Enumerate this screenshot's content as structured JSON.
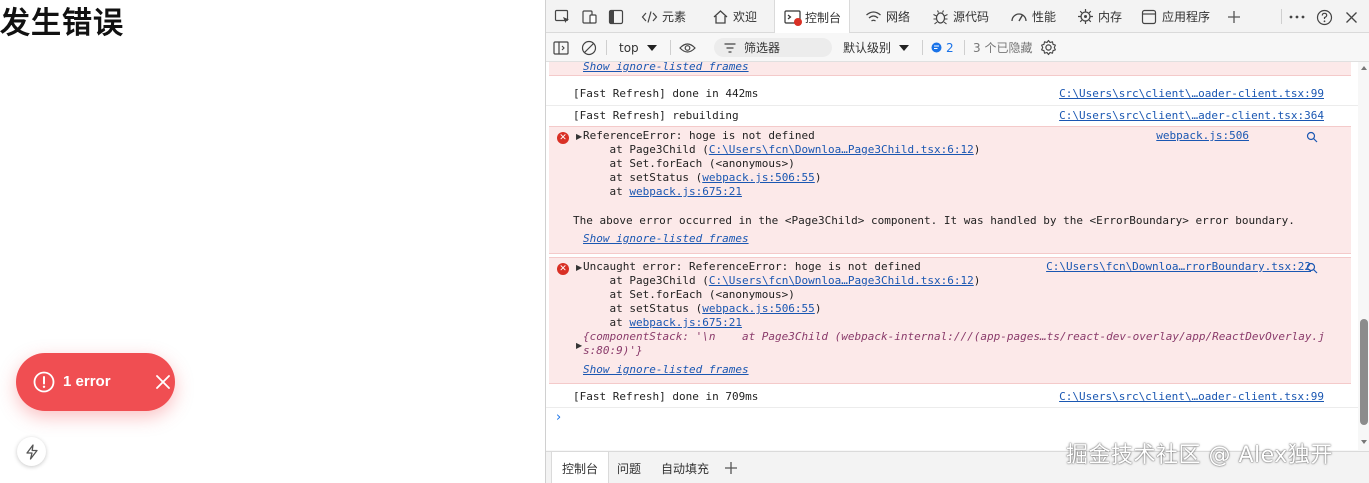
{
  "page": {
    "title": "发生错误",
    "toast": {
      "label": "1 error"
    }
  },
  "devtools": {
    "tabs": [
      {
        "label": "元素",
        "icon": "code-icon"
      },
      {
        "label": "欢迎",
        "icon": "home-icon"
      },
      {
        "label": "控制台",
        "icon": "console-icon"
      },
      {
        "label": "网络",
        "icon": "wifi-icon"
      },
      {
        "label": "源代码",
        "icon": "bug-icon"
      },
      {
        "label": "性能",
        "icon": "performance-icon"
      },
      {
        "label": "内存",
        "icon": "memory-icon"
      },
      {
        "label": "应用程序",
        "icon": "application-icon"
      }
    ],
    "toolbar": {
      "context": "top",
      "filter_placeholder": "筛选器",
      "level": "默认级别",
      "issues_count": "2",
      "hidden": "3 个已隐藏"
    },
    "console": {
      "show_frames": "Show ignore-listed frames",
      "rows": [
        {
          "msg": "[Fast Refresh] done in 442ms",
          "src": "C:\\Users\\src\\client\\…oader-client.tsx:99"
        },
        {
          "msg": "[Fast Refresh] rebuilding",
          "src": "C:\\Users\\src\\client\\…ader-client.tsx:364"
        },
        {
          "msg": "[Fast Refresh] done in 709ms",
          "src": "C:\\Users\\src\\client\\…oader-client.tsx:99"
        }
      ],
      "error1": {
        "head": "ReferenceError: hoge is not defined",
        "src": "webpack.js:506",
        "at1_pre": "    at Page3Child (",
        "at1_link": "C:\\Users\\fcn\\Downloa…Page3Child.tsx:6:12",
        "at1_post": ")",
        "at2": "    at Set.forEach (<anonymous>)",
        "at3_pre": "    at setStatus (",
        "at3_link": "webpack.js:506:55",
        "at3_post": ")",
        "at4_pre": "    at ",
        "at4_link": "webpack.js:675:21",
        "note": "The above error occurred in the <Page3Child> component. It was handled by the <ErrorBoundary> error boundary."
      },
      "error2": {
        "head": "Uncaught error: ReferenceError: hoge is not defined",
        "src": "C:\\Users\\fcn\\Downloa…rrorBoundary.tsx:22",
        "at1_pre": "    at Page3Child (",
        "at1_link": "C:\\Users\\fcn\\Downloa…Page3Child.tsx:6:12",
        "at1_post": ")",
        "at2": "    at Set.forEach (<anonymous>)",
        "at3_pre": "    at setStatus (",
        "at3_link": "webpack.js:506:55",
        "at3_post": ")",
        "at4_pre": "    at ",
        "at4_link": "webpack.js:675:21",
        "obj1": "{componentStack: '\\n    at Page3Child (webpack-internal:///(app-pages…ts/react-dev-overlay/app/ReactDevOverlay.j",
        "obj2": "s:80:9)'}"
      }
    },
    "drawer": [
      "控制台",
      "问题",
      "自动填充"
    ]
  },
  "watermark": "掘金技术社区 @ Alex独开",
  "colors": {
    "toast_bg": "#f04e52",
    "error_bg": "#fce9e9",
    "link": "#1a57b2",
    "error_icon": "#d93025"
  }
}
